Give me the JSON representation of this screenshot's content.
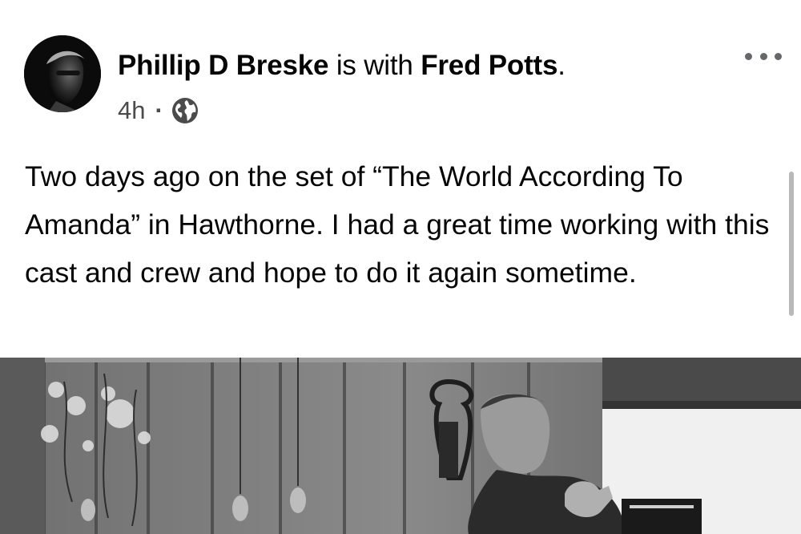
{
  "post": {
    "author": "Phillip D Breske",
    "with_text": "is with",
    "tagged": "Fred Potts",
    "end_punct": ".",
    "time": "4h",
    "separator": "·",
    "audience_icon": "globe-icon",
    "more_icon": "more-horizontal-icon",
    "text": "Two days ago on the set of “The World According To Amanda” in Hawthorne. I had a great time working with this cast and crew and hope to do it again sometime."
  },
  "colors": {
    "text": "#050505",
    "secondary": "#4b4b4b",
    "icon": "#65676b"
  }
}
